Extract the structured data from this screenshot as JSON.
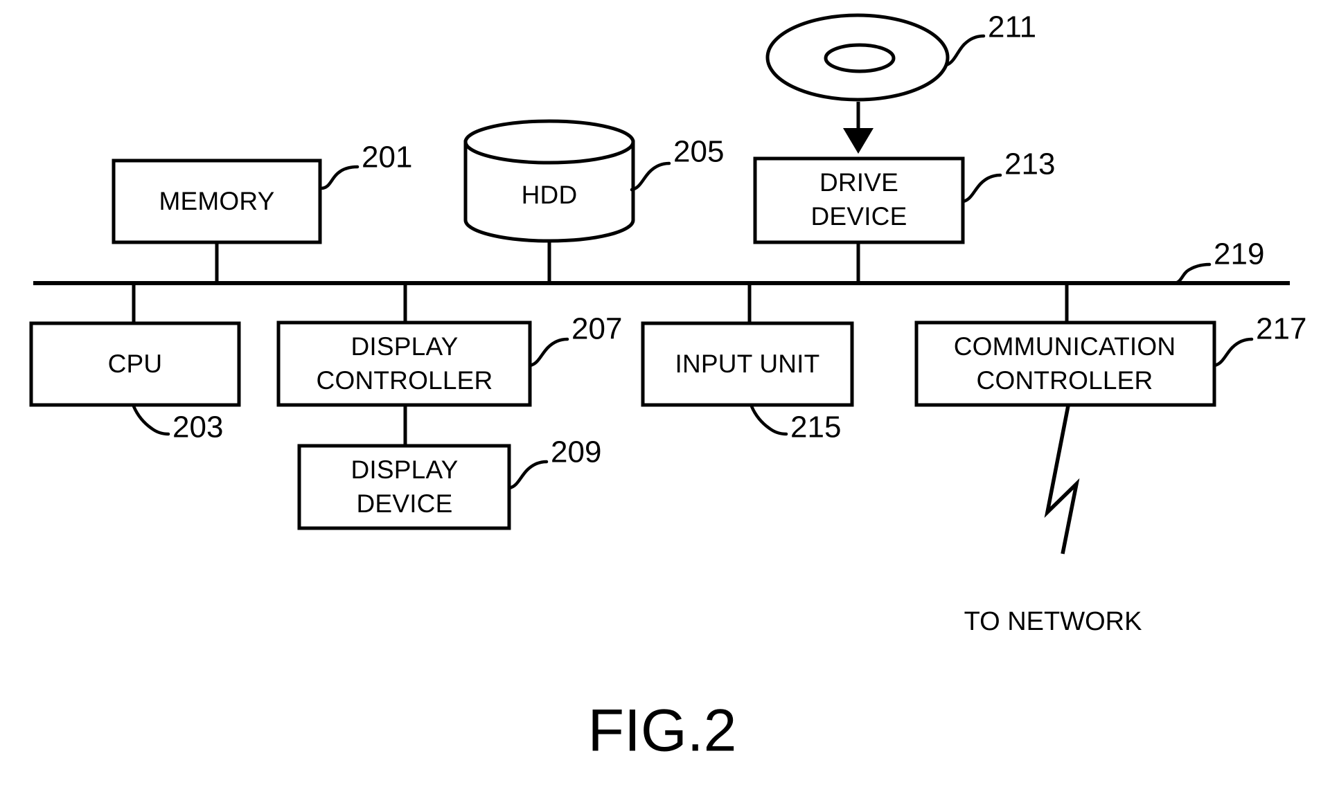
{
  "figure": {
    "caption": "FIG.2",
    "network_label": "TO NETWORK"
  },
  "blocks": {
    "memory": {
      "label": "MEMORY",
      "ref": "201"
    },
    "cpu": {
      "label": "CPU",
      "ref": "203"
    },
    "hdd": {
      "label": "HDD",
      "ref": "205"
    },
    "display_controller": {
      "label_line1": "DISPLAY",
      "label_line2": "CONTROLLER",
      "ref": "207"
    },
    "display_device": {
      "label_line1": "DISPLAY",
      "label_line2": "DEVICE",
      "ref": "209"
    },
    "storage_medium": {
      "label": "",
      "ref": "211"
    },
    "drive_device": {
      "label_line1": "DRIVE",
      "label_line2": "DEVICE",
      "ref": "213"
    },
    "input_unit": {
      "label": "INPUT UNIT",
      "ref": "215"
    },
    "communication_controller": {
      "label_line1": "COMMUNICATION",
      "label_line2": "CONTROLLER",
      "ref": "217"
    },
    "bus": {
      "label": "",
      "ref": "219"
    }
  },
  "colors": {
    "stroke": "#000000",
    "background": "#ffffff"
  }
}
